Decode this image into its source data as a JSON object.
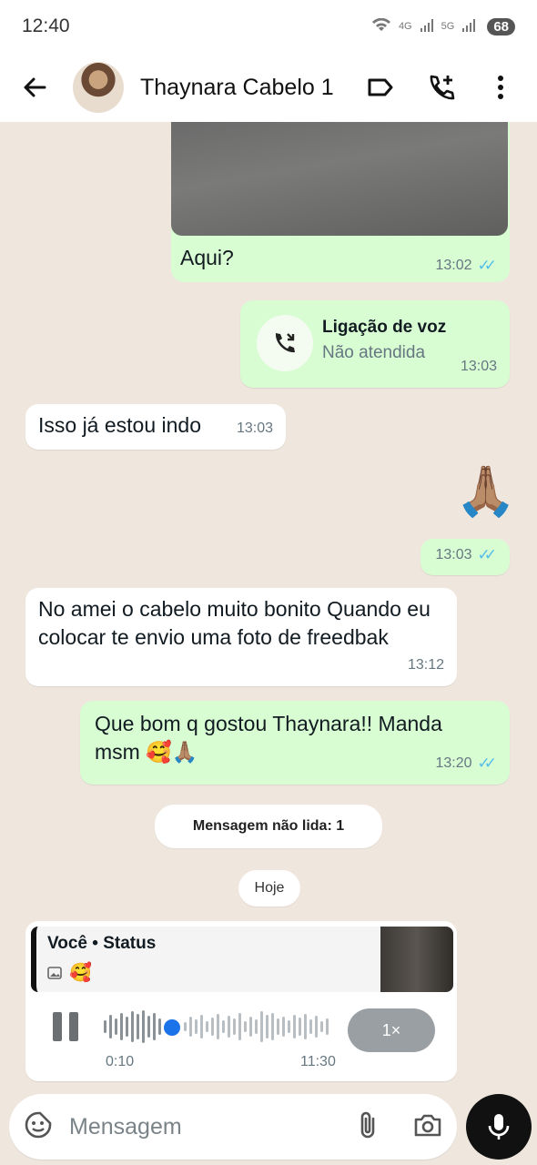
{
  "status_bar": {
    "time": "12:40",
    "network_1": "4G",
    "network_2": "5G",
    "battery": "68"
  },
  "header": {
    "contact_name": "Thaynara Cabelo 1",
    "icons": [
      "back-arrow-icon",
      "label-icon",
      "add-call-icon",
      "more-icon"
    ]
  },
  "messages": [
    {
      "dir": "out",
      "text": "Aqui?",
      "time": "13:02",
      "read": true,
      "has_photo": true
    },
    {
      "dir": "out",
      "type": "call",
      "title": "Ligação de voz",
      "subtitle": "Não atendida",
      "time": "13:03"
    },
    {
      "dir": "in",
      "text": "Isso já estou indo",
      "time": "13:03"
    },
    {
      "dir": "out",
      "emoji": "🙏🏽",
      "time": "13:03",
      "read": true
    },
    {
      "dir": "in",
      "text": "No amei o  cabelo muito bonito Quando eu colocar te envio uma foto de freedbak",
      "time": "13:12"
    },
    {
      "dir": "out",
      "text": "Que bom q gostou Thaynara!! Manda msm 🥰🙏🏽",
      "time": "13:20",
      "read": true
    }
  ],
  "unread_pill": "Mensagem não lida: 1",
  "date_pill": "Hoje",
  "voice_reply": {
    "quote_title": "Você • Status",
    "quote_emoji": "🥰",
    "elapsed": "0:10",
    "duration": "11:30",
    "speed": "1×",
    "progress": 0.12
  },
  "composer": {
    "placeholder": "Mensagem"
  },
  "colors": {
    "outgoing_bubble": "#d9fdd3",
    "incoming_bubble": "#ffffff",
    "read_tick": "#53bdeb",
    "background": "#efe7de"
  }
}
